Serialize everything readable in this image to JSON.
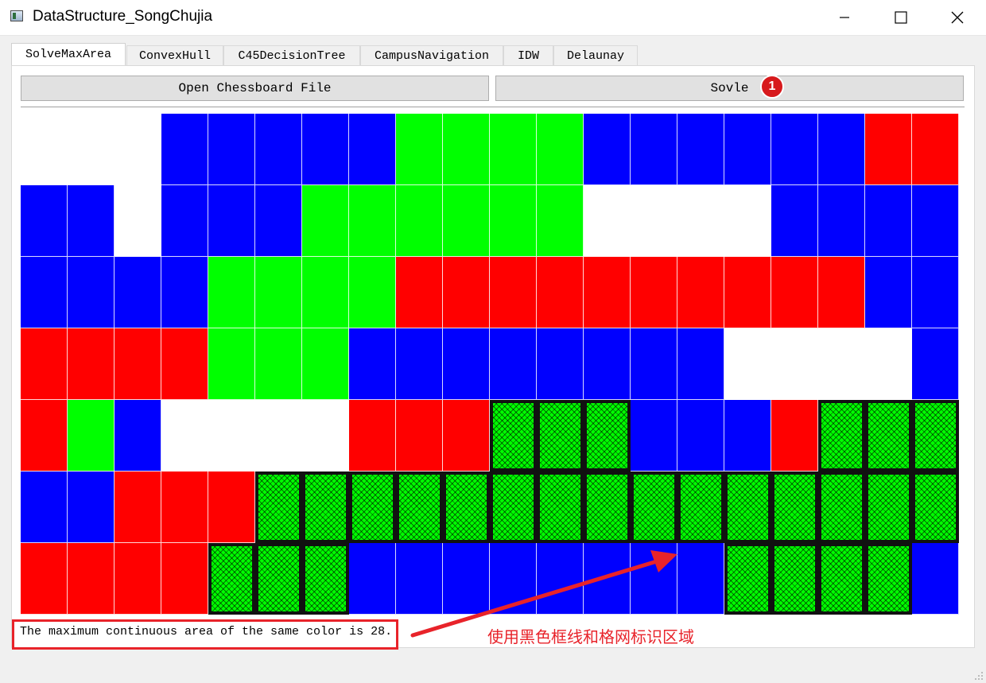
{
  "window": {
    "title": "DataStructure_SongChujia",
    "app_icon": "app-window-icon"
  },
  "window_controls": [
    {
      "name": "minimize-button",
      "icon": "minimize-icon"
    },
    {
      "name": "maximize-button",
      "icon": "maximize-icon"
    },
    {
      "name": "close-button",
      "icon": "close-icon"
    }
  ],
  "tabs": [
    {
      "label": "SolveMaxArea",
      "active": true
    },
    {
      "label": "ConvexHull",
      "active": false
    },
    {
      "label": "C45DecisionTree",
      "active": false
    },
    {
      "label": "CampusNavigation",
      "active": false
    },
    {
      "label": "IDW",
      "active": false
    },
    {
      "label": "Delaunay",
      "active": false
    }
  ],
  "toolbar": {
    "open_label": "Open Chessboard File",
    "solve_label": "Sovle",
    "badge": "1"
  },
  "board": {
    "rows": 7,
    "cols": 20,
    "colors": {
      "W": "#ffffff",
      "B": "#0000ff",
      "G": "#00ff00",
      "R": "#ff0000"
    },
    "grid": [
      "WWWBBBBBGGGGBBBBBBRR",
      "BBWBBBGGGGGGWWWWBBBB",
      "BBBBGGGGRRRRRRRRRRBB",
      "RRRRGGGBBBBBBBBWWWWB",
      "RGBWWWWRRRGGGBBBRGGG",
      "BBRRRGGGGGGGGGGGGGGG",
      "RRRRGGGBBBBBBBBGGGGB"
    ],
    "highlighted": [
      [
        4,
        10
      ],
      [
        4,
        11
      ],
      [
        4,
        12
      ],
      [
        4,
        17
      ],
      [
        4,
        18
      ],
      [
        4,
        19
      ],
      [
        5,
        5
      ],
      [
        5,
        6
      ],
      [
        5,
        7
      ],
      [
        5,
        8
      ],
      [
        5,
        9
      ],
      [
        5,
        10
      ],
      [
        5,
        11
      ],
      [
        5,
        12
      ],
      [
        5,
        13
      ],
      [
        5,
        14
      ],
      [
        5,
        15
      ],
      [
        5,
        16
      ],
      [
        5,
        17
      ],
      [
        5,
        18
      ],
      [
        5,
        19
      ],
      [
        6,
        4
      ],
      [
        6,
        5
      ],
      [
        6,
        6
      ],
      [
        6,
        15
      ],
      [
        6,
        16
      ],
      [
        6,
        17
      ],
      [
        6,
        18
      ]
    ]
  },
  "result": {
    "text": "The maximum continuous area of the same color is 28."
  },
  "annotation": {
    "text": "使用黑色框线和格网标识区域",
    "color": "#e8232a"
  }
}
